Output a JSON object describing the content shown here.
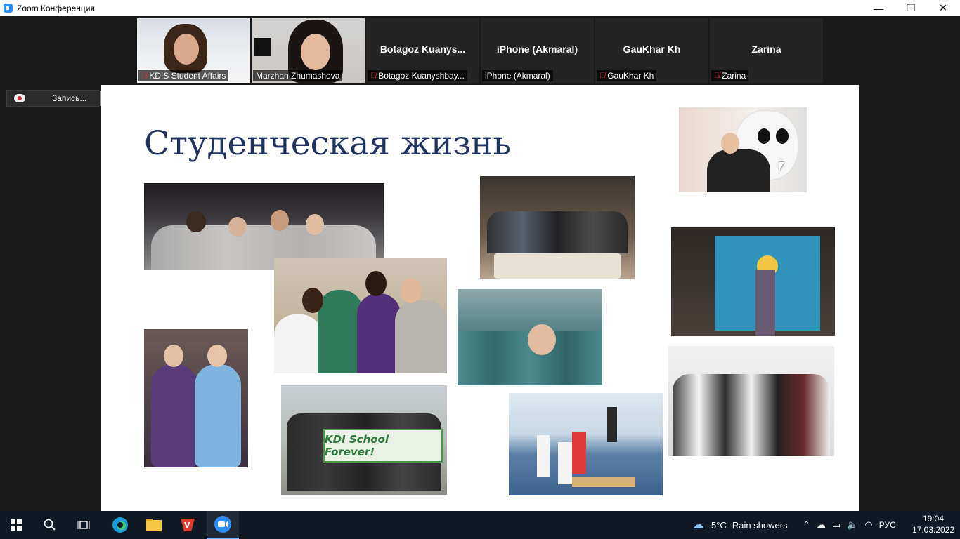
{
  "window": {
    "title": "Zoom Конференция",
    "controls": {
      "minimize": "—",
      "restore": "❐",
      "close": "✕"
    }
  },
  "participants": [
    {
      "display_name": "KDIS Student Affairs",
      "big_name": "",
      "has_video": true,
      "muted": true,
      "active_speaker": false
    },
    {
      "display_name": "Marzhan Zhumasheva",
      "big_name": "",
      "has_video": true,
      "muted": false,
      "active_speaker": true
    },
    {
      "display_name": "Botagoz Kuanyshbay...",
      "big_name": "Botagoz  Kuanys...",
      "has_video": false,
      "muted": true,
      "active_speaker": false
    },
    {
      "display_name": "iPhone (Akmaral)",
      "big_name": "iPhone (Akmaral)",
      "has_video": false,
      "muted": false,
      "active_speaker": false
    },
    {
      "display_name": "GauKhar Kh",
      "big_name": "GauKhar Kh",
      "has_video": false,
      "muted": true,
      "active_speaker": false
    },
    {
      "display_name": "Zarina",
      "big_name": "Zarina",
      "has_video": false,
      "muted": true,
      "active_speaker": false
    }
  ],
  "recording": {
    "label": "Запись..."
  },
  "slide": {
    "title": "Студенческая жизнь",
    "photos": [
      {
        "name": "photo-students-gathering",
        "color": "#3c3a3d"
      },
      {
        "name": "photo-friends-smiling",
        "color": "#9b8a70"
      },
      {
        "name": "photo-costume-panda",
        "color": "#e8e0d8"
      },
      {
        "name": "photo-dinner-group",
        "color": "#6d5d4e"
      },
      {
        "name": "photo-kazakh-flag",
        "color": "#2f93b9"
      },
      {
        "name": "photo-graduation",
        "color": "#3e7478"
      },
      {
        "name": "photo-traditional-costumes",
        "color": "#5a4b6b"
      },
      {
        "name": "photo-taekwondo-group",
        "color": "#c9c9c9"
      },
      {
        "name": "photo-kdi-banner",
        "color": "#8fa48a"
      },
      {
        "name": "photo-taekwondo-match",
        "color": "#5b7fa6"
      }
    ],
    "banner_text": "KDI School Forever!"
  },
  "taskbar": {
    "weather_temp": "5°C",
    "weather_desc": "Rain showers",
    "language": "РУС",
    "time": "19:04",
    "date": "17.03.2022"
  }
}
